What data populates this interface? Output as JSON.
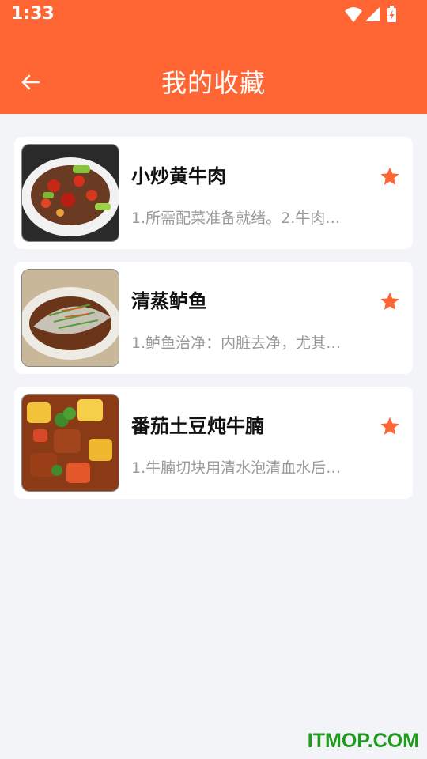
{
  "status_bar": {
    "time": "1:33",
    "icons": [
      "wifi-icon",
      "signal-icon",
      "battery-charging-icon"
    ]
  },
  "header": {
    "title": "我的收藏",
    "back_icon": "arrow-left-icon"
  },
  "colors": {
    "accent": "#ff6633",
    "background": "#f3f4f8",
    "card": "#ffffff",
    "watermark": "#1f9c1f"
  },
  "favorites": [
    {
      "name": "小炒黄牛肉",
      "desc": "1.所需配菜准备就绪。2.牛肉…",
      "icon": "star-icon"
    },
    {
      "name": "清蒸鲈鱼",
      "desc": "1.鲈鱼治净：内脏去净，尤其…",
      "icon": "star-icon"
    },
    {
      "name": "番茄土豆炖牛腩",
      "desc": "1.牛腩切块用清水泡清血水后…",
      "icon": "star-icon"
    }
  ],
  "watermark": "ITMOP.COM"
}
